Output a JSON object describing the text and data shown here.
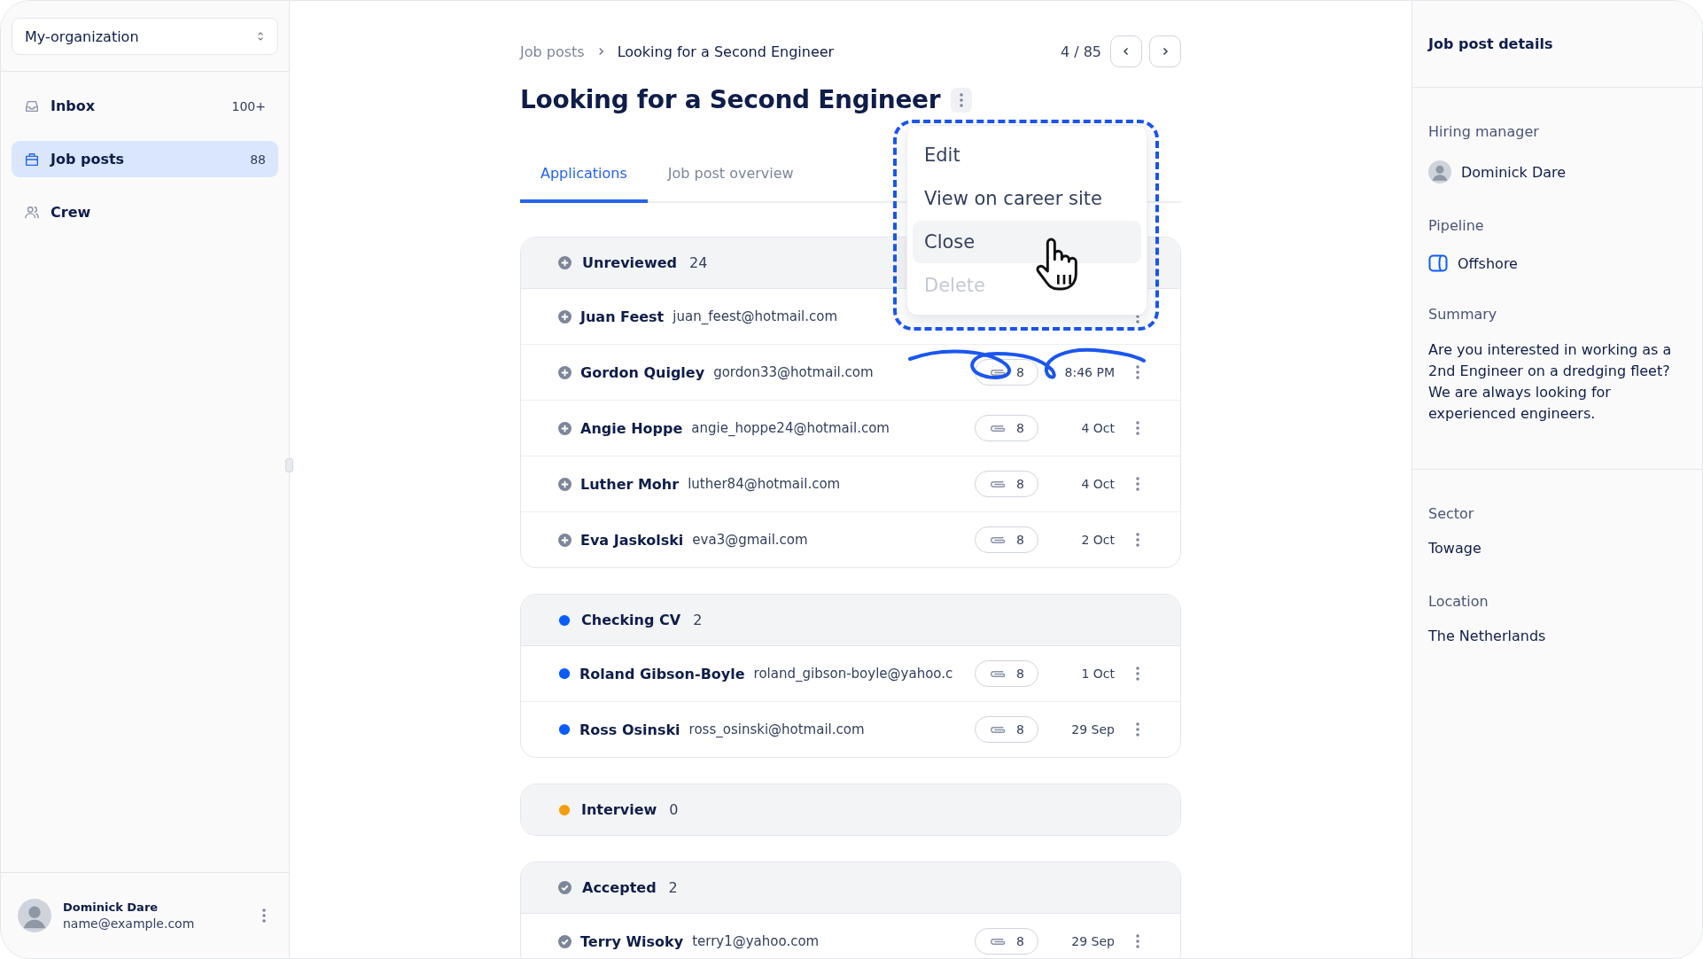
{
  "sidebar": {
    "org_selector": {
      "value": "My-organization"
    },
    "items": [
      {
        "label": "Inbox",
        "count": "100+",
        "selected": false
      },
      {
        "label": "Job posts",
        "count": "88",
        "selected": true
      },
      {
        "label": "Crew",
        "selected": false
      }
    ],
    "user": {
      "name": "Dominick Dare",
      "email": "name@example.com"
    }
  },
  "breadcrumb": [
    "Job posts",
    "Looking for a Second Engineer"
  ],
  "pager": "4 / 85",
  "title": "Looking for a Second Engineer",
  "tabs": [
    {
      "label": "Applications",
      "selected": true
    },
    {
      "label": "Job post overview",
      "selected": false
    }
  ],
  "menu": {
    "items": [
      {
        "label": "Edit",
        "hovered": false,
        "disabled": false
      },
      {
        "label": "View on career site",
        "hovered": false,
        "disabled": false
      },
      {
        "label": "Close",
        "hovered": true,
        "disabled": false
      },
      {
        "label": "Delete",
        "hovered": false,
        "disabled": true
      }
    ]
  },
  "groups": [
    {
      "name": "Unreviewed",
      "count": "24",
      "kind": "plus",
      "applicants": [
        {
          "name": "Juan Feest",
          "email": "juan_feest@hotmail.com"
        },
        {
          "name": "Gordon Quigley",
          "email": "gordon33@hotmail.com",
          "attachments": "8",
          "date": "8:46 PM"
        },
        {
          "name": "Angie Hoppe",
          "email": "angie_hoppe24@hotmail.com",
          "attachments": "8",
          "date": "4 Oct"
        },
        {
          "name": "Luther Mohr",
          "email": "luther84@hotmail.com",
          "attachments": "8",
          "date": "4 Oct"
        },
        {
          "name": "Eva Jaskolski",
          "email": "eva3@gmail.com",
          "attachments": "8",
          "date": "2 Oct"
        }
      ]
    },
    {
      "name": "Checking CV",
      "count": "2",
      "kind": "dot",
      "color": "#0a5cff",
      "applicants": [
        {
          "name": "Roland Gibson-Boyle",
          "email": "roland_gibson-boyle@yahoo.c",
          "attachments": "8",
          "date": "1 Oct"
        },
        {
          "name": "Ross Osinski",
          "email": "ross_osinski@hotmail.com",
          "attachments": "8",
          "date": "29 Sep"
        }
      ]
    },
    {
      "name": "Interview",
      "count": "0",
      "kind": "dot",
      "color": "#f59e0b"
    },
    {
      "name": "Accepted",
      "count": "2",
      "kind": "check",
      "applicants": [
        {
          "name": "Terry Wisoky",
          "email": "terry1@yahoo.com",
          "attachments": "8",
          "date": "29 Sep"
        }
      ]
    }
  ],
  "details": {
    "title": "Job post details",
    "sections": [
      [
        {
          "label": "Hiring manager",
          "value": "Dominick Dare",
          "kind": "person"
        },
        {
          "label": "Pipeline",
          "value": "Offshore",
          "kind": "pipeline"
        },
        {
          "label": "Summary",
          "value": "Are you interested in working as a 2nd Engineer on a dredging fleet? We are always looking for experienced engineers.",
          "kind": "text"
        }
      ],
      [
        {
          "label": "Sector",
          "value": "Towage",
          "kind": "text"
        },
        {
          "label": "Location",
          "value": "The Netherlands",
          "kind": "text"
        }
      ]
    ]
  }
}
